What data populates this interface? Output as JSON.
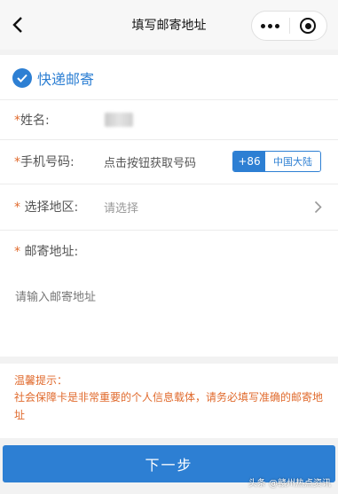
{
  "navbar": {
    "title": "填写邮寄地址",
    "back_icon": "chevron-left-icon",
    "more_icon": "more-dots-icon",
    "close_icon": "target-circle-icon"
  },
  "delivery_method": {
    "label": "快递邮寄",
    "selected": true,
    "check_icon": "check-circle-icon"
  },
  "form": {
    "name": {
      "required_mark": "*",
      "label": "姓名:"
    },
    "phone": {
      "required_mark": "*",
      "label": "手机号码:",
      "value": "点击按钮获取号码",
      "country_code": "+86",
      "region": "中国大陆"
    },
    "area": {
      "required_mark": "*",
      "label": "选择地区:",
      "placeholder": "请选择",
      "chevron_icon": "chevron-right-icon"
    },
    "address": {
      "required_mark": "*",
      "label": "邮寄地址:",
      "placeholder": "请输入邮寄地址"
    }
  },
  "tips": {
    "title": "温馨提示：",
    "body": "社会保障卡是非常重要的个人信息载体，请务必填写准确的邮寄地址"
  },
  "next_button": {
    "label": "下一步"
  },
  "watermark": "头条 @赣州热点资讯",
  "colors": {
    "accent": "#2d7fd3",
    "warning": "#e06a2c"
  }
}
